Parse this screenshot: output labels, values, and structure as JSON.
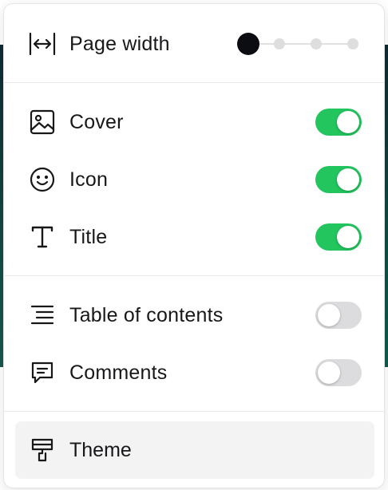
{
  "menu": {
    "page_width": {
      "label": "Page width",
      "icon": "page-width-icon",
      "steps": 4,
      "selected_step": 1
    },
    "cover": {
      "label": "Cover",
      "icon": "image-icon",
      "enabled": true
    },
    "icon": {
      "label": "Icon",
      "icon": "smiley-icon",
      "enabled": true
    },
    "title": {
      "label": "Title",
      "icon": "text-type-icon",
      "enabled": true
    },
    "toc": {
      "label": "Table of contents",
      "icon": "list-icon",
      "enabled": false
    },
    "comments": {
      "label": "Comments",
      "icon": "comment-icon",
      "enabled": false
    },
    "theme": {
      "label": "Theme",
      "icon": "paint-roller-icon"
    }
  },
  "colors": {
    "toggle_on": "#22c55e",
    "toggle_off": "#dcdcdf",
    "active_step": "#0b0d12"
  }
}
